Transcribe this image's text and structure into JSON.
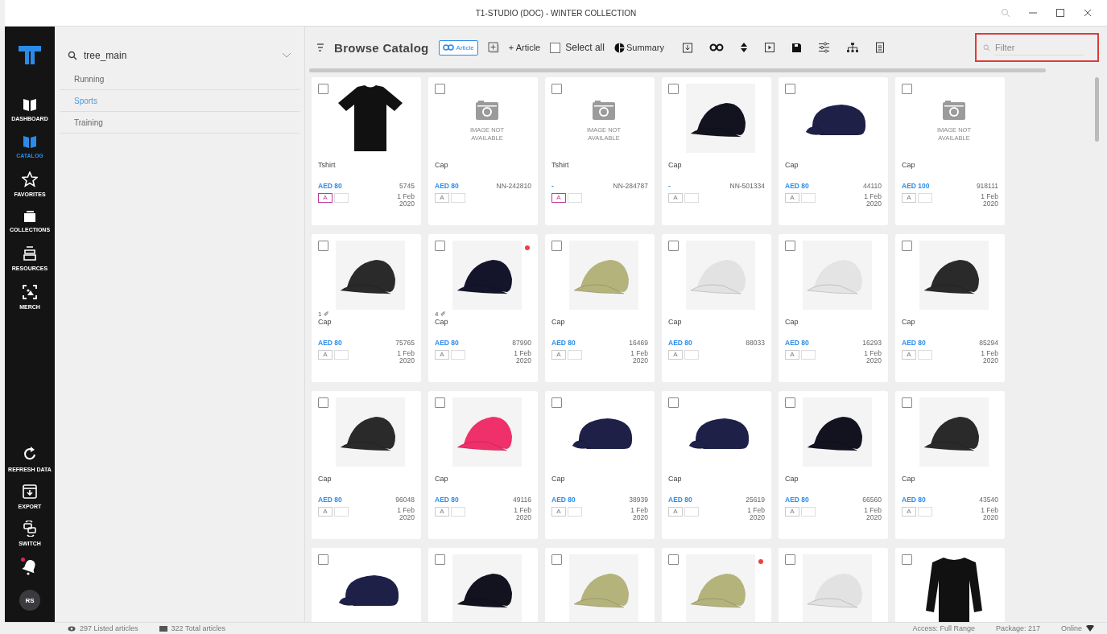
{
  "window": {
    "title": "T1-STUDIO (DOC) - WINTER COLLECTION"
  },
  "nav": {
    "top": [
      {
        "kind": "dashboard",
        "label": "DASHBOARD",
        "selected": false
      },
      {
        "kind": "catalog",
        "label": "CATALOG",
        "selected": true
      },
      {
        "kind": "favorites",
        "label": "FAVORITES",
        "selected": false
      },
      {
        "kind": "collections",
        "label": "COLLECTIONS",
        "selected": false
      },
      {
        "kind": "resources",
        "label": "RESOURCES",
        "selected": false
      },
      {
        "kind": "merch",
        "label": "MERCH",
        "selected": false
      }
    ],
    "bottom": [
      {
        "kind": "refresh",
        "label": "REFRESH DATA",
        "selected": false
      },
      {
        "kind": "export",
        "label": "EXPORT",
        "selected": false
      },
      {
        "kind": "switch",
        "label": "SWITCH",
        "selected": false
      }
    ],
    "bell_alert": true,
    "avatar": "RS"
  },
  "tree": {
    "search": "tree_main",
    "items": [
      {
        "label": "Running",
        "selected": false
      },
      {
        "label": "Sports",
        "selected": true
      },
      {
        "label": "Training",
        "selected": false
      }
    ]
  },
  "toolbar": {
    "title": "Browse Catalog",
    "article_toggle": {
      "label": "Article",
      "selected": true
    },
    "add_article": "+ Article",
    "select_all": {
      "label": "Select all",
      "checked": false
    },
    "summary": "Summary",
    "filter": {
      "placeholder": "Filter"
    }
  },
  "cards": [
    {
      "checked": false,
      "image": {
        "kind": "tshirt",
        "color": "#111111"
      },
      "name": "Tshirt",
      "price": "AED 80",
      "code": "5745",
      "date": "1 Feb 2020",
      "tag": {
        "label": "A",
        "on": true
      },
      "flagged": false
    },
    {
      "checked": false,
      "image": {
        "kind": "none",
        "text": "IMAGE NOT AVAILABLE"
      },
      "name": "Cap",
      "price": "AED 80",
      "code": "NN-242810",
      "tag": {
        "label": "A",
        "on": false
      },
      "flagged": false
    },
    {
      "checked": false,
      "image": {
        "kind": "none",
        "text": "IMAGE NOT AVAILABLE"
      },
      "name": "Tshirt",
      "price": "-",
      "code": "NN-284787",
      "tag": {
        "label": "A",
        "on": true
      },
      "flagged": false
    },
    {
      "checked": false,
      "image": {
        "kind": "cap",
        "color": "#12131f"
      },
      "name": "Cap",
      "price": "-",
      "code": "NN-501334",
      "tag": {
        "label": "A",
        "on": false
      },
      "flagged": false
    },
    {
      "checked": false,
      "image": {
        "kind": "flatcap",
        "color": "#1e2048"
      },
      "name": "Cap",
      "price": "AED 80",
      "code": "44110",
      "date": "1 Feb 2020",
      "tag": {
        "label": "A",
        "on": false
      },
      "flagged": false
    },
    {
      "checked": false,
      "image": {
        "kind": "none",
        "text": "IMAGE NOT AVAILABLE"
      },
      "name": "Cap",
      "price": "AED 100",
      "code": "918111",
      "date": "1 Feb 2020",
      "tag": {
        "label": "A",
        "on": false
      },
      "flagged": false
    },
    {
      "checked": false,
      "image": {
        "kind": "cap",
        "color": "#2a2a2a"
      },
      "note": "1 ✐",
      "name": "Cap",
      "price": "AED 80",
      "code": "75765",
      "date": "1 Feb 2020",
      "tag": {
        "label": "A",
        "on": false
      },
      "flagged": false
    },
    {
      "checked": false,
      "image": {
        "kind": "cap",
        "color": "#14152a"
      },
      "note": "4 ✐",
      "name": "Cap",
      "price": "AED 80",
      "code": "87990",
      "date": "1 Feb 2020",
      "tag": {
        "label": "A",
        "on": false
      },
      "flagged": true
    },
    {
      "checked": false,
      "image": {
        "kind": "cap",
        "color": "#b5b37c"
      },
      "name": "Cap",
      "price": "AED 80",
      "code": "16469",
      "date": "1 Feb 2020",
      "tag": {
        "label": "A",
        "on": false
      },
      "flagged": false
    },
    {
      "checked": false,
      "image": {
        "kind": "cap",
        "color": "#e2e2e2"
      },
      "name": "Cap",
      "price": "AED 80",
      "code": "88033",
      "tag": {
        "label": "A",
        "on": false
      },
      "flagged": false
    },
    {
      "checked": false,
      "image": {
        "kind": "cap",
        "color": "#e4e4e4"
      },
      "name": "Cap",
      "price": "AED 80",
      "code": "16293",
      "date": "1 Feb 2020",
      "tag": {
        "label": "A",
        "on": false
      },
      "flagged": false
    },
    {
      "checked": false,
      "image": {
        "kind": "cap",
        "color": "#2a2a2a"
      },
      "name": "Cap",
      "price": "AED 80",
      "code": "85294",
      "date": "1 Feb 2020",
      "tag": {
        "label": "A",
        "on": false
      },
      "flagged": false
    },
    {
      "checked": false,
      "image": {
        "kind": "cap",
        "color": "#2a2a2a"
      },
      "name": "Cap",
      "price": "AED 80",
      "code": "96048",
      "date": "1 Feb 2020",
      "tag": {
        "label": "A",
        "on": false
      },
      "flagged": false
    },
    {
      "checked": false,
      "image": {
        "kind": "cap",
        "color": "#f0306a"
      },
      "name": "Cap",
      "price": "AED 80",
      "code": "49116",
      "date": "1 Feb 2020",
      "tag": {
        "label": "A",
        "on": false
      },
      "flagged": false
    },
    {
      "checked": false,
      "image": {
        "kind": "flatcap",
        "color": "#1e2048"
      },
      "name": "Cap",
      "price": "AED 80",
      "code": "38939",
      "date": "1 Feb 2020",
      "tag": {
        "label": "A",
        "on": false
      },
      "flagged": false
    },
    {
      "checked": false,
      "image": {
        "kind": "flatcap",
        "color": "#1e2048"
      },
      "name": "Cap",
      "price": "AED 80",
      "code": "25619",
      "date": "1 Feb 2020",
      "tag": {
        "label": "A",
        "on": false
      },
      "flagged": false
    },
    {
      "checked": false,
      "image": {
        "kind": "cap",
        "color": "#12131f"
      },
      "name": "Cap",
      "price": "AED 80",
      "code": "66560",
      "date": "1 Feb 2020",
      "tag": {
        "label": "A",
        "on": false
      },
      "flagged": false
    },
    {
      "checked": false,
      "image": {
        "kind": "cap",
        "color": "#2a2a2a"
      },
      "name": "Cap",
      "price": "AED 80",
      "code": "43540",
      "date": "1 Feb 2020",
      "tag": {
        "label": "A",
        "on": false
      },
      "flagged": false
    },
    {
      "checked": false,
      "image": {
        "kind": "flatcap",
        "color": "#1e2048"
      },
      "flagged": false
    },
    {
      "checked": false,
      "image": {
        "kind": "cap",
        "color": "#12131f"
      },
      "flagged": false
    },
    {
      "checked": false,
      "image": {
        "kind": "cap",
        "color": "#b5b37c"
      },
      "flagged": false
    },
    {
      "checked": false,
      "image": {
        "kind": "cap",
        "color": "#b5b37c"
      },
      "flagged": true
    },
    {
      "checked": false,
      "image": {
        "kind": "cap",
        "color": "#e2e2e2"
      },
      "flagged": false
    },
    {
      "checked": false,
      "image": {
        "kind": "sweater",
        "color": "#111111"
      },
      "flagged": false
    }
  ],
  "status_bar": {
    "listed": "297 Listed articles",
    "total": "322 Total articles",
    "access": "Access: Full Range",
    "package": "Package: 217",
    "online": "Online"
  }
}
